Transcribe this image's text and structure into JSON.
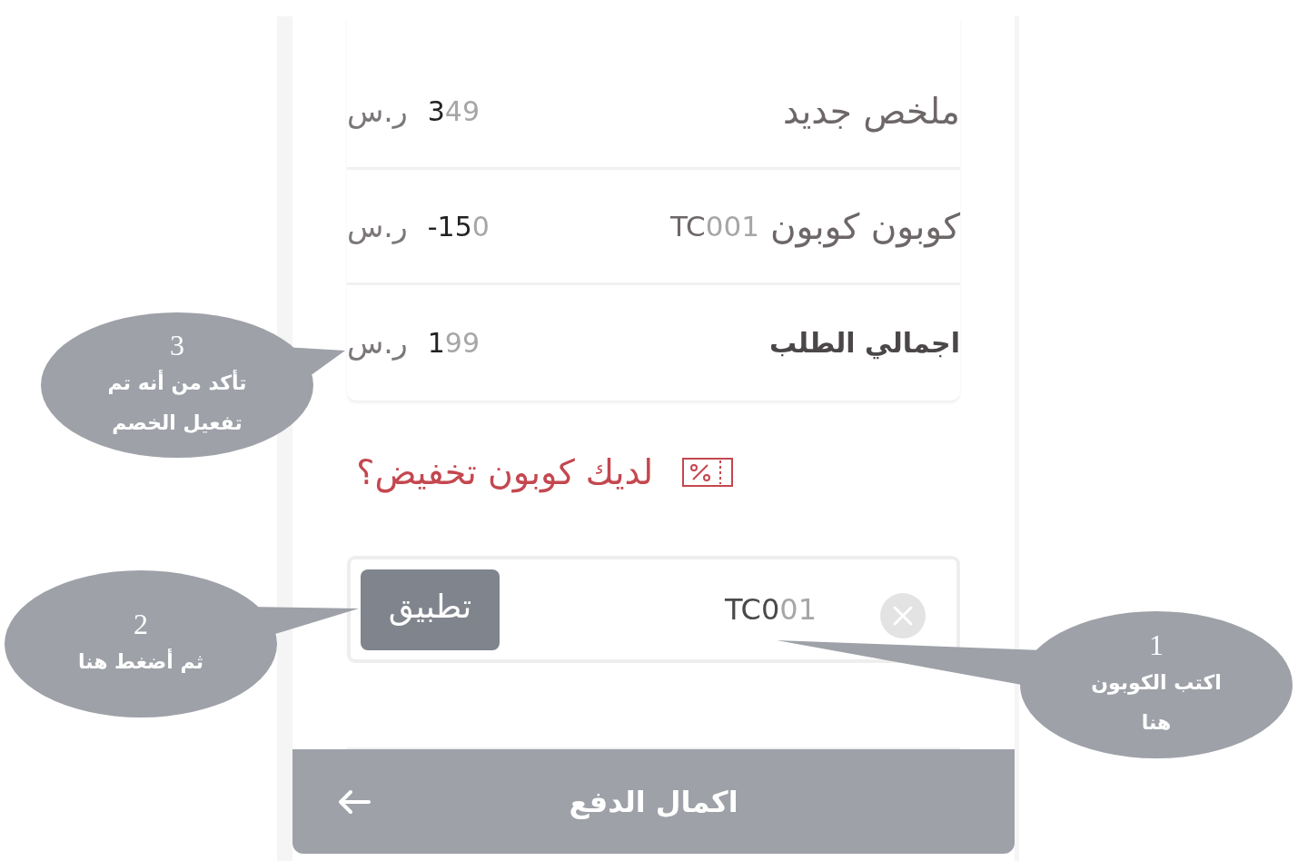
{
  "order_summary": {
    "rows": [
      {
        "kind": "line",
        "label": "ملخص جديد",
        "amount": {
          "clear": "3",
          "faded": "49"
        },
        "currency": "ر.س"
      },
      {
        "kind": "line",
        "label": "كوبون كوبون",
        "code": {
          "clear": "TC",
          "faded": "001"
        },
        "amount": {
          "clear": "-15",
          "faded": "0"
        },
        "currency": "ر.س"
      },
      {
        "kind": "total",
        "label": "اجمالي الطلب",
        "amount": {
          "clear": "1",
          "faded": "99"
        },
        "currency": "ر.س"
      }
    ]
  },
  "coupon_prompt": {
    "text": "لديك كوبون تخفيض؟"
  },
  "coupon_form": {
    "value": {
      "clear": "TC0",
      "faded": "01"
    },
    "apply_button": "تطبيق"
  },
  "checkout_button": {
    "label": "اكمال الدفع"
  },
  "callouts": [
    {
      "number": "3",
      "text": "تأكد من أنه تم\nتفعيل الخصم"
    },
    {
      "number": "2",
      "text": "ثم أضغط هنا"
    },
    {
      "number": "1",
      "text": "اكتب الكوبون\nهنا"
    }
  ]
}
